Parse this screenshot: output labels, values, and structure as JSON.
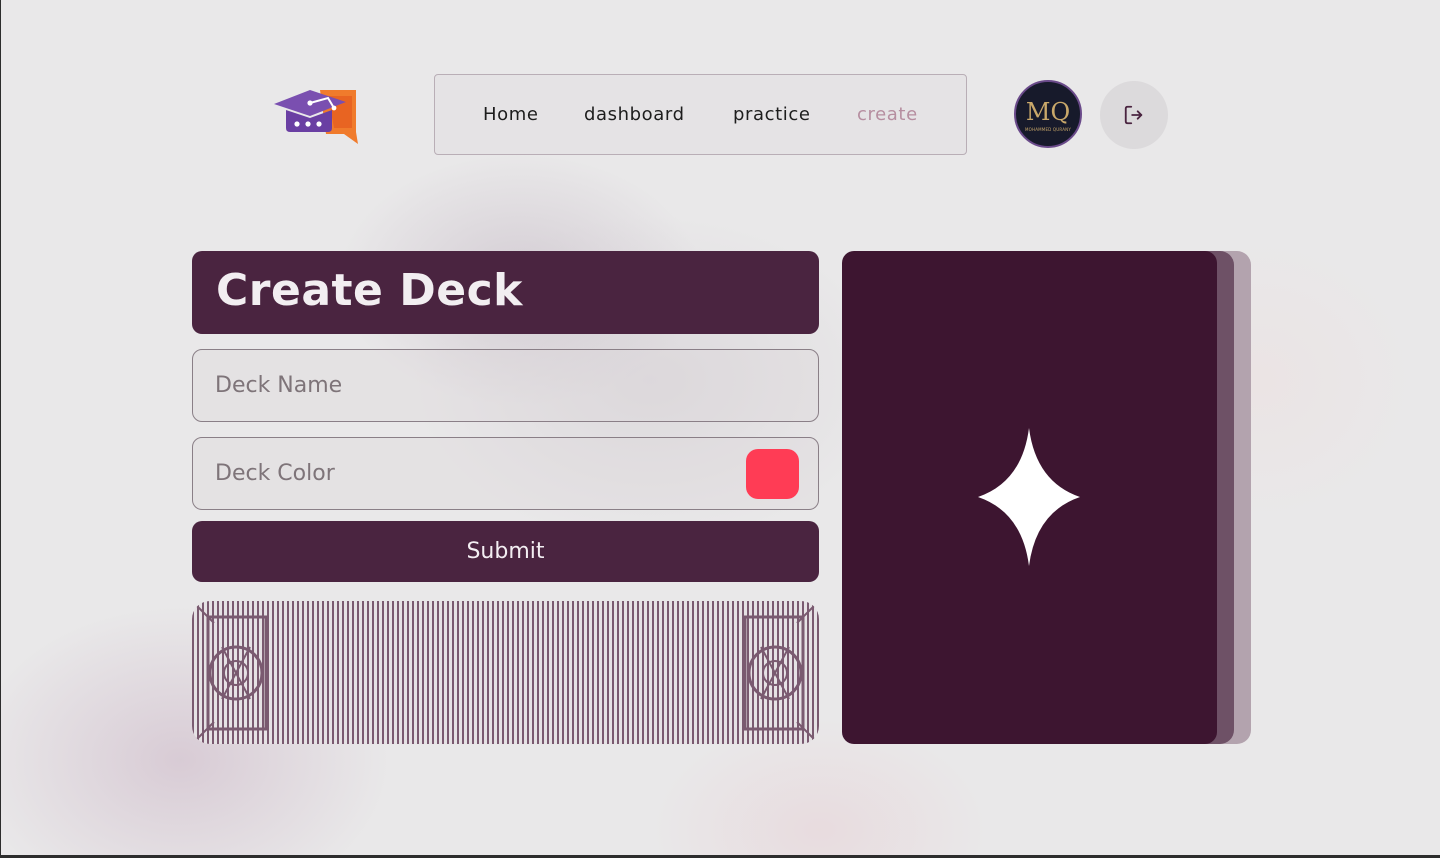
{
  "app": {
    "logo_name": "graduation-cap-chat-logo"
  },
  "nav": {
    "items": [
      {
        "label": "Home",
        "active": false
      },
      {
        "label": "dashboard",
        "active": false
      },
      {
        "label": "practice",
        "active": false
      },
      {
        "label": "create",
        "active": true
      }
    ]
  },
  "user": {
    "avatar_initials": "MQ",
    "avatar_caption": "MOHAMMED QURANY"
  },
  "header_actions": {
    "logout_icon": "logout-icon"
  },
  "form": {
    "title": "Create Deck",
    "deck_name": {
      "value": "",
      "placeholder": "Deck Name"
    },
    "deck_color": {
      "value": "",
      "placeholder": "Deck Color",
      "selected_color": "#ff3c55"
    },
    "submit_label": "Submit"
  },
  "preview": {
    "card_color": "#3d1530",
    "stack_colors": [
      "#6e5166",
      "#b3a3ae"
    ],
    "icon": "sparkle-icon"
  },
  "colors": {
    "accent": "#4a2440",
    "nav_active": "#b68ea0",
    "background": "#e9e8e9"
  }
}
